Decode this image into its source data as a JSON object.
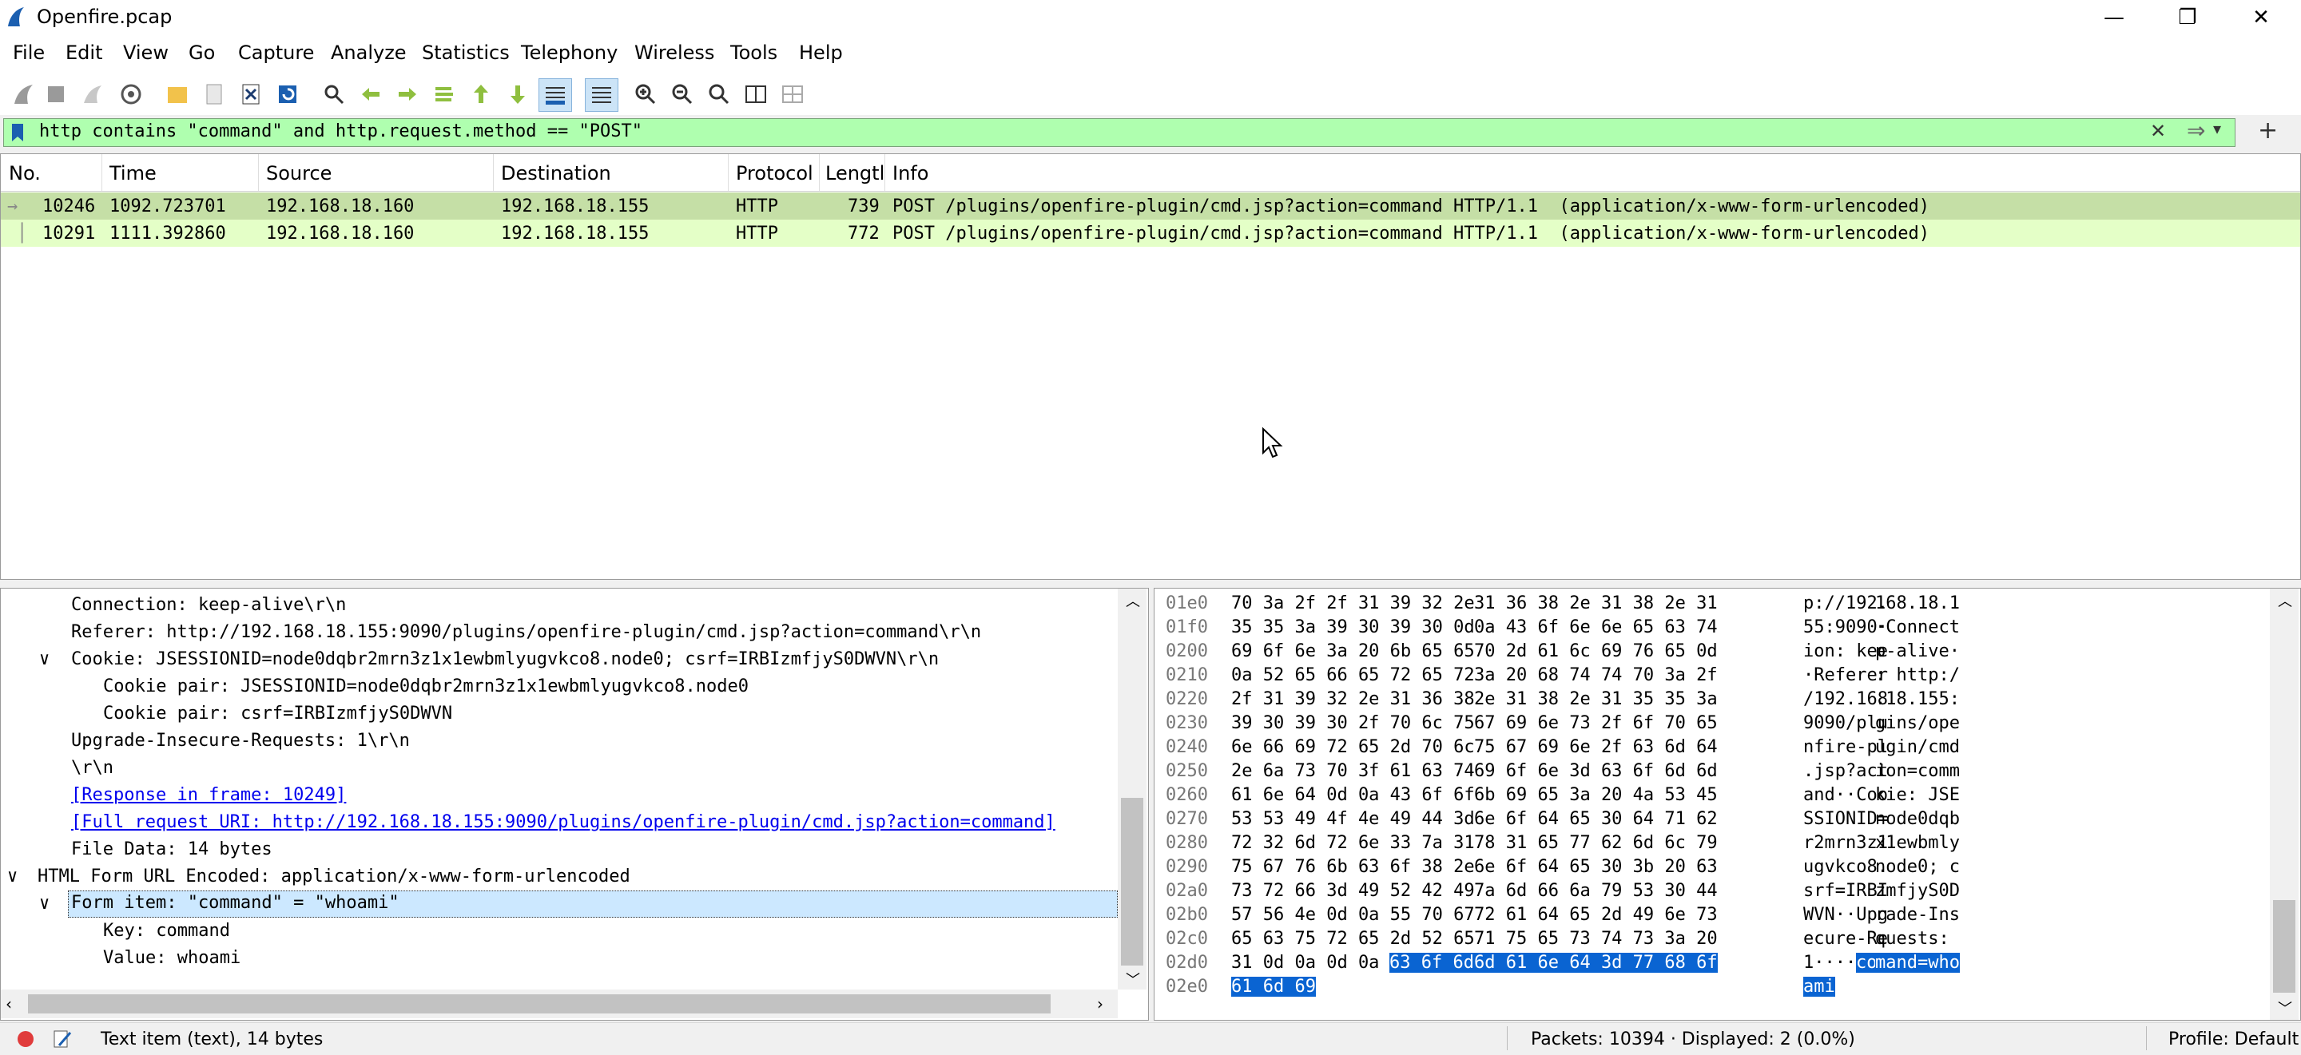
{
  "window": {
    "title": "Openfire.pcap",
    "minimize": "—",
    "restore": "❐",
    "close": "✕"
  },
  "menu": [
    "File",
    "Edit",
    "View",
    "Go",
    "Capture",
    "Analyze",
    "Statistics",
    "Telephony",
    "Wireless",
    "Tools",
    "Help"
  ],
  "filter": {
    "text": "http contains \"command\" and http.request.method == \"POST\"",
    "clear": "✕",
    "apply": "⇒",
    "dropdown": "▾",
    "add": "+"
  },
  "packet_list": {
    "columns": [
      "No.",
      "Time",
      "Source",
      "Destination",
      "Protocol",
      "Lengtl",
      "Info"
    ],
    "rows": [
      {
        "no": "10246",
        "time": "1092.723701",
        "src": "192.168.18.160",
        "dst": "192.168.18.155",
        "proto": "HTTP",
        "len": "739",
        "info": "POST /plugins/openfire-plugin/cmd.jsp?action=command HTTP/1.1  (application/x-www-form-urlencoded)",
        "marker": "→"
      },
      {
        "no": "10291",
        "time": "1111.392860",
        "src": "192.168.18.160",
        "dst": "192.168.18.155",
        "proto": "HTTP",
        "len": "772",
        "info": "POST /plugins/openfire-plugin/cmd.jsp?action=command HTTP/1.1  (application/x-www-form-urlencoded)",
        "marker": ""
      }
    ]
  },
  "details": [
    {
      "text": "Connection: keep-alive\\r\\n",
      "indent": 1,
      "arrow": "",
      "link": false
    },
    {
      "text": "Referer: http://192.168.18.155:9090/plugins/openfire-plugin/cmd.jsp?action=command\\r\\n",
      "indent": 1,
      "arrow": "",
      "link": false
    },
    {
      "text": "Cookie: JSESSIONID=node0dqbr2mrn3z1x1ewbmlyugvkco8.node0; csrf=IRBIzmfjyS0DWVN\\r\\n",
      "indent": 1,
      "arrow": "∨",
      "link": false
    },
    {
      "text": "Cookie pair: JSESSIONID=node0dqbr2mrn3z1x1ewbmlyugvkco8.node0",
      "indent": 2,
      "arrow": "",
      "link": false
    },
    {
      "text": "Cookie pair: csrf=IRBIzmfjyS0DWVN",
      "indent": 2,
      "arrow": "",
      "link": false
    },
    {
      "text": "Upgrade-Insecure-Requests: 1\\r\\n",
      "indent": 1,
      "arrow": "",
      "link": false
    },
    {
      "text": "\\r\\n",
      "indent": 1,
      "arrow": "",
      "link": false
    },
    {
      "text": "[Response in frame: 10249]",
      "indent": 1,
      "arrow": "",
      "link": true
    },
    {
      "text": "[Full request URI: http://192.168.18.155:9090/plugins/openfire-plugin/cmd.jsp?action=command]",
      "indent": 1,
      "arrow": "",
      "link": true
    },
    {
      "text": "File Data: 14 bytes",
      "indent": 1,
      "arrow": "",
      "link": false
    },
    {
      "text": "HTML Form URL Encoded: application/x-www-form-urlencoded",
      "indent": 0,
      "arrow": "∨",
      "link": false
    },
    {
      "text": "Form item: \"command\" = \"whoami\"",
      "indent": 1,
      "arrow": "∨",
      "link": false,
      "selected": true
    },
    {
      "text": "Key: command",
      "indent": 2,
      "arrow": "",
      "link": false
    },
    {
      "text": "Value: whoami",
      "indent": 2,
      "arrow": "",
      "link": false
    }
  ],
  "bytes": [
    {
      "off": "01e0",
      "h1": "70 3a 2f 2f 31 39 32 2e",
      "h2": "31 36 38 2e 31 38 2e 31",
      "a1": "p://192.",
      "a2": "168.18.1"
    },
    {
      "off": "01f0",
      "h1": "35 35 3a 39 30 39 30 0d",
      "h2": "0a 43 6f 6e 6e 65 63 74",
      "a1": "55:9090·",
      "a2": "·Connect"
    },
    {
      "off": "0200",
      "h1": "69 6f 6e 3a 20 6b 65 65",
      "h2": "70 2d 61 6c 69 76 65 0d",
      "a1": "ion: kee",
      "a2": "p-alive·"
    },
    {
      "off": "0210",
      "h1": "0a 52 65 66 65 72 65 72",
      "h2": "3a 20 68 74 74 70 3a 2f",
      "a1": "·Referer",
      "a2": ": http:/"
    },
    {
      "off": "0220",
      "h1": "2f 31 39 32 2e 31 36 38",
      "h2": "2e 31 38 2e 31 35 35 3a",
      "a1": "/192.168",
      "a2": ".18.155:"
    },
    {
      "off": "0230",
      "h1": "39 30 39 30 2f 70 6c 75",
      "h2": "67 69 6e 73 2f 6f 70 65",
      "a1": "9090/plu",
      "a2": "gins/ope"
    },
    {
      "off": "0240",
      "h1": "6e 66 69 72 65 2d 70 6c",
      "h2": "75 67 69 6e 2f 63 6d 64",
      "a1": "nfire-pl",
      "a2": "ugin/cmd"
    },
    {
      "off": "0250",
      "h1": "2e 6a 73 70 3f 61 63 74",
      "h2": "69 6f 6e 3d 63 6f 6d 6d",
      "a1": ".jsp?act",
      "a2": "ion=comm"
    },
    {
      "off": "0260",
      "h1": "61 6e 64 0d 0a 43 6f 6f",
      "h2": "6b 69 65 3a 20 4a 53 45",
      "a1": "and··Coo",
      "a2": "kie: JSE"
    },
    {
      "off": "0270",
      "h1": "53 53 49 4f 4e 49 44 3d",
      "h2": "6e 6f 64 65 30 64 71 62",
      "a1": "SSIONID=",
      "a2": "node0dqb"
    },
    {
      "off": "0280",
      "h1": "72 32 6d 72 6e 33 7a 31",
      "h2": "78 31 65 77 62 6d 6c 79",
      "a1": "r2mrn3z1",
      "a2": "x1ewbmly"
    },
    {
      "off": "0290",
      "h1": "75 67 76 6b 63 6f 38 2e",
      "h2": "6e 6f 64 65 30 3b 20 63",
      "a1": "ugvkco8.",
      "a2": "node0; c"
    },
    {
      "off": "02a0",
      "h1": "73 72 66 3d 49 52 42 49",
      "h2": "7a 6d 66 6a 79 53 30 44",
      "a1": "srf=IRBI",
      "a2": "zmfjyS0D"
    },
    {
      "off": "02b0",
      "h1": "57 56 4e 0d 0a 55 70 67",
      "h2": "72 61 64 65 2d 49 6e 73",
      "a1": "WVN··Upg",
      "a2": "rade-Ins"
    },
    {
      "off": "02c0",
      "h1": "65 63 75 72 65 2d 52 65",
      "h2": "71 75 65 73 74 73 3a 20",
      "a1": "ecure-Re",
      "a2": "quests: "
    },
    {
      "off": "02d0",
      "h1": "31 0d 0a 0d 0a",
      "h1_hl": "63 6f 6d",
      "h2": "",
      "h2_hl": "6d 61 6e 64 3d 77 68 6f",
      "a1": "1····",
      "a1_hl": "com",
      "a2": "",
      "a2_hl": "mand=who"
    },
    {
      "off": "02e0",
      "h1": "",
      "h1_hl": "61 6d 69",
      "h2": "",
      "h2_hl": "",
      "a1": "",
      "a1_hl": "ami",
      "a2": "",
      "a2_hl": ""
    }
  ],
  "status": {
    "left_text": "Text item (text), 14 bytes",
    "packets": "Packets: 10394 · Displayed: 2 (0.0%)",
    "profile": "Profile: Default"
  },
  "colors": {
    "filter_ok": "#afffaf",
    "row1": "#c5dfa6",
    "row2": "#e4ffc7",
    "selected_hex": "#0a64d2",
    "selected_tree": "#cce8ff"
  }
}
